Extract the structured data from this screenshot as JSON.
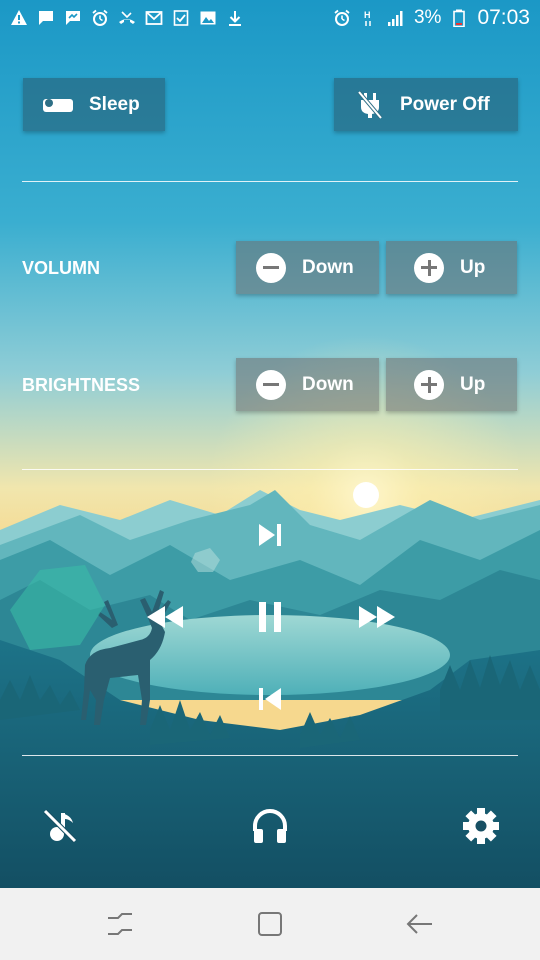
{
  "status_bar": {
    "left_icons": [
      "alert-icon",
      "message-icon",
      "messenger-icon",
      "alarm-icon",
      "missed-call-icon",
      "gmail-icon",
      "task-icon",
      "image-icon",
      "download-icon"
    ],
    "right_icons": [
      "alarm-icon",
      "h-network-icon",
      "signal-icon",
      "battery-icon"
    ],
    "battery": "3%",
    "time": "07:03"
  },
  "top_buttons": {
    "sleep_label": "Sleep",
    "power_off_label": "Power Off"
  },
  "volume": {
    "label": "VOLUMN",
    "down_label": "Down",
    "up_label": "Up"
  },
  "brightness": {
    "label": "BRIGHTNESS",
    "down_label": "Down",
    "up_label": "Up"
  },
  "media_controls": [
    "next-track-icon",
    "rewind-icon",
    "pause-icon",
    "fast-forward-icon",
    "previous-track-icon"
  ],
  "bottom_bar": [
    "music-off-icon",
    "headphones-icon",
    "settings-gear-icon"
  ],
  "nav_bar": [
    "recent-apps-icon",
    "home-icon",
    "back-icon"
  ],
  "colors": {
    "sky_top": "#1e9ec9",
    "sky_mid": "#8fcfd6",
    "sky_glow": "#f3e7a8",
    "mountain": "#3ea0a8",
    "valley": "#1a6f80",
    "bottom": "#134f63",
    "nav_bg": "#f1f1f1"
  }
}
